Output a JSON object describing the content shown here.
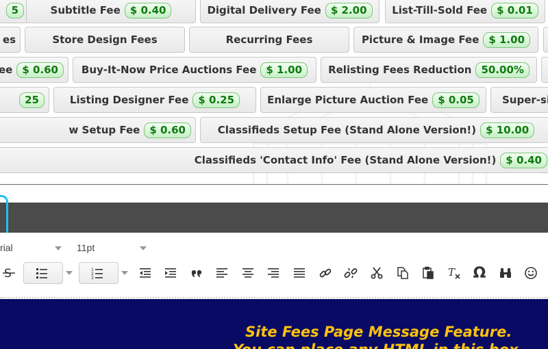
{
  "fees": [
    {
      "id": "r1c1",
      "label": "",
      "price": "5",
      "edge": "left"
    },
    {
      "id": "r1c2",
      "label": "Subtitle Fee",
      "price": "$ 0.40"
    },
    {
      "id": "r1c3",
      "label": "Digital Delivery Fee",
      "price": "$ 2.00"
    },
    {
      "id": "r1c4",
      "label": "List-Till-Sold Fee",
      "price": "$ 0.01"
    },
    {
      "id": "r2c1",
      "label": "es",
      "price": "",
      "edge": "left"
    },
    {
      "id": "r2c2",
      "label": "Store Design Fees",
      "price": ""
    },
    {
      "id": "r2c3",
      "label": "Recurring Fees",
      "price": ""
    },
    {
      "id": "r2c4",
      "label": "Picture & Image Fee",
      "price": "$ 1.00"
    },
    {
      "id": "r3c1",
      "label": "ee",
      "price": "$ 0.60",
      "edge": "left"
    },
    {
      "id": "r3c2",
      "label": "Buy-It-Now Price Auctions Fee",
      "price": "$ 1.00"
    },
    {
      "id": "r3c3",
      "label": "Relisting Fees Reduction",
      "price": "50.00%"
    },
    {
      "id": "r4c1",
      "label": "",
      "price": "25",
      "edge": "left"
    },
    {
      "id": "r4c2",
      "label": "Listing Designer Fee",
      "price": "$ 0.25"
    },
    {
      "id": "r4c3",
      "label": "Enlarge Picture Auction Fee",
      "price": "$ 0.05"
    },
    {
      "id": "r4c4",
      "label": "Super-si",
      "price": "",
      "edge": "right"
    },
    {
      "id": "r5c1",
      "label": "w Setup Fee",
      "price": "$ 0.60",
      "edge": "left"
    },
    {
      "id": "r5c2",
      "label": "Classifieds Setup Fee (Stand Alone Version!)",
      "price": "$ 10.00"
    },
    {
      "id": "r6c1",
      "label": "Classifieds 'Contact Info' Fee (Stand Alone Version!)",
      "price": "$ 0.40",
      "edge": "left"
    }
  ],
  "editor": {
    "font_family": "rial",
    "font_size": "11pt",
    "tools": [
      {
        "id": "strikethrough",
        "icon": "strikethrough-icon"
      },
      {
        "id": "bullet-list",
        "icon": "bullet-list-icon"
      },
      {
        "id": "numbered-list",
        "icon": "numbered-list-icon"
      },
      {
        "id": "outdent",
        "icon": "outdent-icon"
      },
      {
        "id": "indent",
        "icon": "indent-icon"
      },
      {
        "id": "blockquote",
        "icon": "quote-icon"
      },
      {
        "id": "align-left",
        "icon": "align-left-icon"
      },
      {
        "id": "align-center",
        "icon": "align-center-icon"
      },
      {
        "id": "align-right",
        "icon": "align-right-icon"
      },
      {
        "id": "align-justify",
        "icon": "align-justify-icon"
      },
      {
        "id": "insert-link",
        "icon": "link-icon"
      },
      {
        "id": "remove-link",
        "icon": "unlink-icon"
      },
      {
        "id": "cut",
        "icon": "scissors-icon"
      },
      {
        "id": "copy",
        "icon": "copy-icon"
      },
      {
        "id": "paste",
        "icon": "paste-icon"
      },
      {
        "id": "clear-formatting",
        "icon": "clear-format-icon"
      },
      {
        "id": "special-char",
        "icon": "omega-icon",
        "glyph": "Ω"
      },
      {
        "id": "find",
        "icon": "binoculars-icon"
      },
      {
        "id": "emoticon",
        "icon": "smiley-icon"
      }
    ]
  },
  "message": {
    "line1": "Site Fees Page Message Feature.",
    "line2": "You can place any HTML in this box"
  },
  "colors": {
    "message_bg": "#080a63",
    "message_text": "#ffc20e",
    "price_text": "#0f7a0f",
    "focus_ring": "#1ec2ee",
    "editor_bar": "#4b4b4b"
  }
}
